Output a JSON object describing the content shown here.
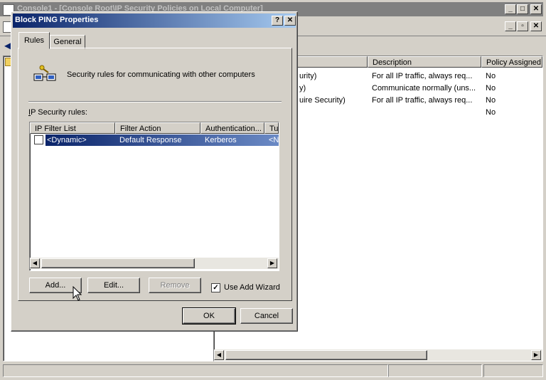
{
  "bg_window": {
    "title": "Console1 - [Console Root\\IP Security Policies on Local Computer]",
    "columns": [
      "Description",
      "Policy Assigned"
    ],
    "rows": [
      {
        "name_tail": "urity)",
        "description": "For all IP traffic, always req...",
        "assigned": "No"
      },
      {
        "name_tail": "y)",
        "description": "Communicate normally (uns...",
        "assigned": "No"
      },
      {
        "name_tail": "uire Security)",
        "description": "For all IP traffic, always req...",
        "assigned": "No"
      },
      {
        "name_tail": "",
        "description": "",
        "assigned": "No"
      }
    ]
  },
  "dialog": {
    "title": "Block PING Properties",
    "help_glyph": "?",
    "close_glyph": "✕",
    "tabs": [
      "Rules",
      "General"
    ],
    "intro_text": "Security rules for communicating with other computers",
    "rules_label_prefix": "I",
    "rules_label_rest": "P Security rules:",
    "list": {
      "columns": [
        "IP Filter List",
        "Filter Action",
        "Authentication...",
        "Tu"
      ],
      "rows": [
        {
          "filter_list": "<Dynamic>",
          "filter_action": "Default Response",
          "auth": "Kerberos",
          "tunnel": "<N",
          "checked": false,
          "selected": true
        }
      ]
    },
    "buttons": {
      "add": "Add...",
      "edit": "Edit...",
      "remove": "Remove",
      "ok": "OK",
      "cancel": "Cancel"
    },
    "use_wizard_label": "Use Add Wizard",
    "use_wizard_checked": true
  },
  "colors": {
    "selection": "#0a246a",
    "selection_light": "#6b8ac5",
    "face": "#d4d0c8"
  }
}
